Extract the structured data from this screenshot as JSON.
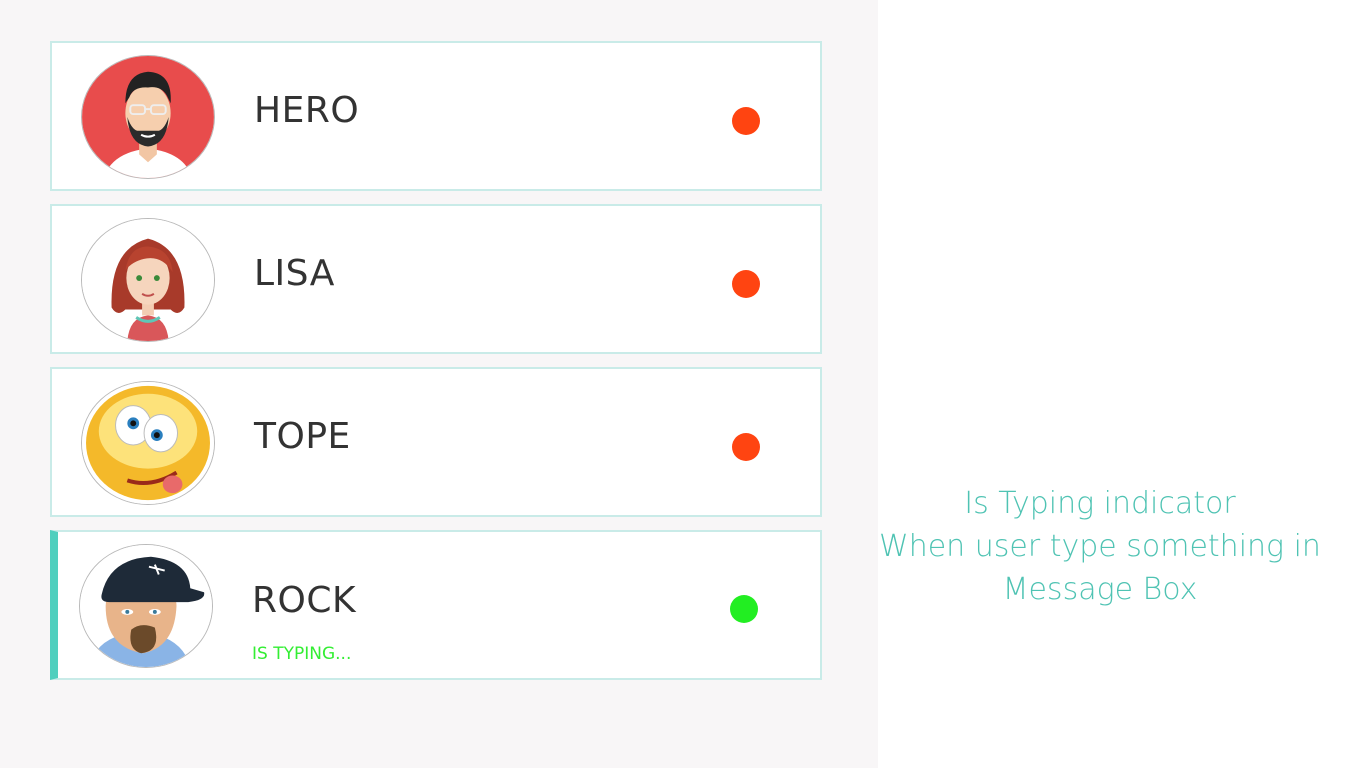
{
  "contacts": [
    {
      "name": "HERO",
      "avatar": "man-with-glasses-avatar",
      "status_color": "#ff4411",
      "typing": ""
    },
    {
      "name": "LISA",
      "avatar": "woman-red-hair-avatar",
      "status_color": "#ff4411",
      "typing": ""
    },
    {
      "name": "TOPE",
      "avatar": "silly-face-emoji-avatar",
      "status_color": "#ff4411",
      "typing": ""
    },
    {
      "name": "ROCK",
      "avatar": "man-with-cap-avatar",
      "status_color": "#22ee22",
      "typing": "IS TYPING..."
    }
  ],
  "caption": {
    "line1": "Is Typing indicator",
    "line2": "When user type something in",
    "line3": "Message Box"
  },
  "colors": {
    "accent": "#4fc3b3",
    "active_border": "#4fcfbe",
    "card_border": "#c9ebe8",
    "offline": "#ff4411",
    "online": "#22ee22",
    "typing_text": "#33ee33"
  }
}
